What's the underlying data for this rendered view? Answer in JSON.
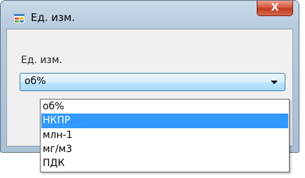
{
  "window": {
    "title": "Ед. изм.",
    "close_label": "X"
  },
  "form": {
    "field_label": "Ед. изм.",
    "selected_value": "об%"
  },
  "dropdown": {
    "items": [
      {
        "label": "об%"
      },
      {
        "label": "НКПР"
      },
      {
        "label": "млн-1"
      },
      {
        "label": "мг/м3"
      },
      {
        "label": "ПДК"
      }
    ],
    "highlighted_item": "НКПР"
  },
  "colors": {
    "highlight": "#3399ff",
    "close_button": "#c13a20"
  }
}
